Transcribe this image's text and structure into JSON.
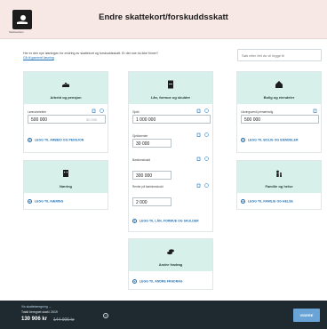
{
  "header": {
    "logo_caption": "Skatteetaten",
    "title": "Endre skattekort/forskuddsskatt"
  },
  "intro": {
    "text": "Her er den nye løsningen for endring av skattekort og forskuddsskatt. Er det noe du ikke finner?",
    "link": "Gå til gammel løsning"
  },
  "search": {
    "placeholder": "Søk etter felt du vil legge til"
  },
  "cards": {
    "arbeid": {
      "title": "Arbeid og pensjon",
      "field1_label": "Lønnsinntekter",
      "field1_value": "500 000",
      "field1_prev": "50 000",
      "add_label": "LEGG TIL ARBEID OG PENSJON"
    },
    "lan": {
      "title": "Lån, formue og skulder",
      "field1_label": "Gjeld",
      "field1_value": "1 000 000",
      "field2_label": "Gjeldsrenter",
      "field2_value": "30 000",
      "field3_label": "Bankinnskudd",
      "field3_value": "300 000",
      "field4_label": "Renter på bankinnskudd",
      "field4_value": "2 000",
      "add_label": "LEGG TIL LÅN, FORMUE OG SKULDER"
    },
    "bolig": {
      "title": "Bolig og eiendeler",
      "field1_label": "Likningsverdi primærbolig",
      "field1_value": "500 000",
      "add_label": "LEGG TIL BOLIG OG EIENDELER"
    },
    "naering": {
      "title": "Næring",
      "add_label": "LEGG TIL NÆRING"
    },
    "familie": {
      "title": "Familie og helse",
      "add_label": "LEGG TIL FAMILIE OG HELSE"
    },
    "andre": {
      "title": "Andre fradrag",
      "add_label": "LEGG TIL ANDRE FRADRAG"
    }
  },
  "footer": {
    "link": "Vis skatteberegning →",
    "label": "Totalt beregnet skatt i 2019",
    "amount": "130 906 kr",
    "old_amount": "144 906 kr",
    "next_button": "VIDERE"
  },
  "colors": {
    "header_bg": "#f7e8e5",
    "card_head_bg": "#d8f0ea",
    "link": "#1a6fb5",
    "footer_bg": "#1f2a30",
    "next_button": "#6aa3d6"
  }
}
